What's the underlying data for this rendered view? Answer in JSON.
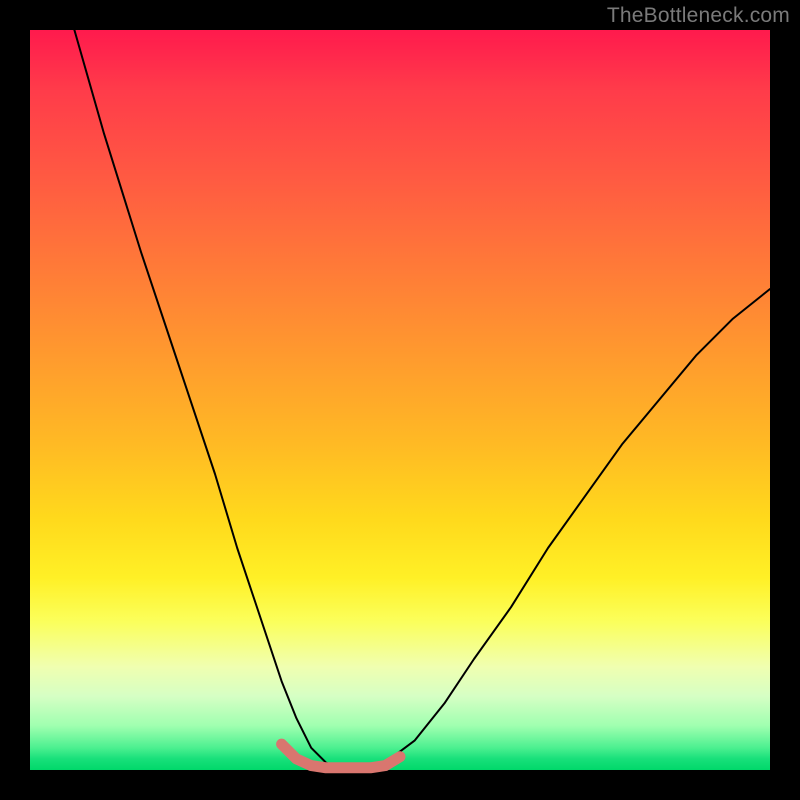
{
  "watermark": "TheBottleneck.com",
  "chart_data": {
    "type": "line",
    "title": "",
    "xlabel": "",
    "ylabel": "",
    "xlim": [
      0,
      100
    ],
    "ylim": [
      0,
      100
    ],
    "grid": false,
    "legend": false,
    "background_gradient_stops": [
      {
        "pos": 0,
        "color": "#ff1a4d"
      },
      {
        "pos": 8,
        "color": "#ff3b4a"
      },
      {
        "pos": 20,
        "color": "#ff5a42"
      },
      {
        "pos": 32,
        "color": "#ff7a38"
      },
      {
        "pos": 44,
        "color": "#ff9a2e"
      },
      {
        "pos": 56,
        "color": "#ffba24"
      },
      {
        "pos": 66,
        "color": "#ffd91c"
      },
      {
        "pos": 74,
        "color": "#fff026"
      },
      {
        "pos": 80,
        "color": "#fbff5c"
      },
      {
        "pos": 86,
        "color": "#f0ffb0"
      },
      {
        "pos": 90,
        "color": "#d6ffc4"
      },
      {
        "pos": 94,
        "color": "#a0ffb0"
      },
      {
        "pos": 97,
        "color": "#4cf090"
      },
      {
        "pos": 98.5,
        "color": "#18e07a"
      },
      {
        "pos": 100,
        "color": "#00d86a"
      }
    ],
    "series": [
      {
        "name": "bottleneck-curve",
        "color": "#000000",
        "stroke_width": 2,
        "x": [
          6,
          10,
          15,
          20,
          25,
          28,
          30,
          32,
          34,
          36,
          38,
          40,
          42,
          44,
          46,
          48,
          52,
          56,
          60,
          65,
          70,
          75,
          80,
          85,
          90,
          95,
          100
        ],
        "y": [
          100,
          86,
          70,
          55,
          40,
          30,
          24,
          18,
          12,
          7,
          3,
          1,
          0,
          0,
          0,
          1,
          4,
          9,
          15,
          22,
          30,
          37,
          44,
          50,
          56,
          61,
          65
        ]
      },
      {
        "name": "bottom-marker-band",
        "color": "#d9766f",
        "stroke_width": 11,
        "x": [
          34,
          36,
          38,
          40,
          42,
          44,
          46,
          48,
          50
        ],
        "y": [
          3.5,
          1.5,
          0.6,
          0.3,
          0.3,
          0.3,
          0.3,
          0.6,
          1.8
        ]
      }
    ],
    "markers": [
      {
        "x": 34,
        "y": 3.5,
        "r": 5,
        "color": "#d9766f"
      },
      {
        "x": 50,
        "y": 1.8,
        "r": 5,
        "color": "#d9766f"
      }
    ]
  }
}
